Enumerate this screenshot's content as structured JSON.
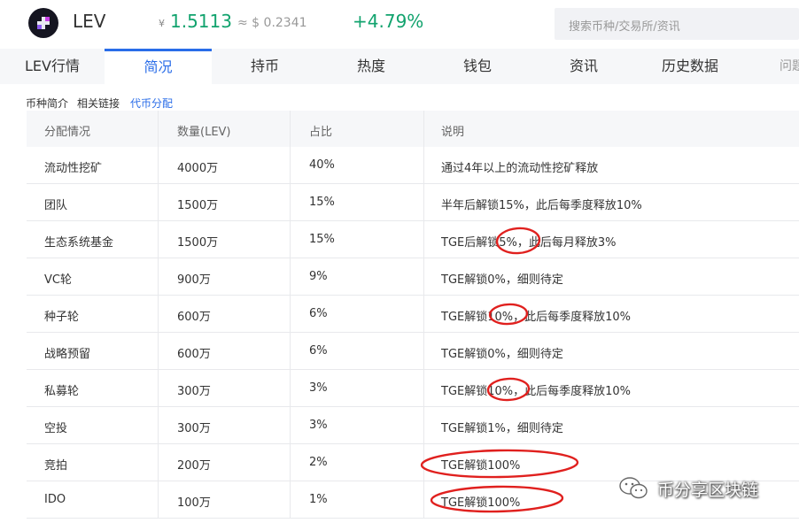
{
  "header": {
    "symbol": "LEV",
    "cny_symbol": "¥",
    "price_cny": "1.5113",
    "price_usd": "≈ $ 0.2341",
    "change": "+4.79%",
    "search_placeholder": "搜索币种/交易所/资讯",
    "up_color": "#12a36e"
  },
  "tabs": [
    {
      "label": "LEV行情"
    },
    {
      "label": "简况"
    },
    {
      "label": "持币"
    },
    {
      "label": "热度"
    },
    {
      "label": "钱包"
    },
    {
      "label": "资讯"
    },
    {
      "label": "历史数据"
    },
    {
      "label": "问题"
    }
  ],
  "subtabs": [
    {
      "label": "币种简介"
    },
    {
      "label": "相关链接"
    },
    {
      "label": "代币分配"
    }
  ],
  "table": {
    "headers": [
      "分配情况",
      "数量(LEV)",
      "占比",
      "说明"
    ],
    "rows": [
      [
        "流动性挖矿",
        "4000万",
        "40%",
        "通过4年以上的流动性挖矿释放"
      ],
      [
        "团队",
        "1500万",
        "15%",
        "半年后解锁15%，此后每季度释放10%"
      ],
      [
        "生态系统基金",
        "1500万",
        "15%",
        "TGE后解锁5%，此后每月释放3%"
      ],
      [
        "VC轮",
        "900万",
        "9%",
        "TGE解锁0%，细则待定"
      ],
      [
        "种子轮",
        "600万",
        "6%",
        "TGE解锁10%，此后每季度释放10%"
      ],
      [
        "战略预留",
        "600万",
        "6%",
        "TGE解锁0%，细则待定"
      ],
      [
        "私募轮",
        "300万",
        "3%",
        "TGE解锁10%，此后每季度释放10%"
      ],
      [
        "空投",
        "300万",
        "3%",
        "TGE解锁1%，细则待定"
      ],
      [
        "竞拍",
        "200万",
        "2%",
        "TGE解锁100%"
      ],
      [
        "IDO",
        "100万",
        "1%",
        "TGE解锁100%"
      ]
    ]
  },
  "watermark": {
    "text": "币分享区块链",
    "icon": "wechat-icon"
  },
  "annotation_color": "#e0201e",
  "accent": "#2a6de8"
}
